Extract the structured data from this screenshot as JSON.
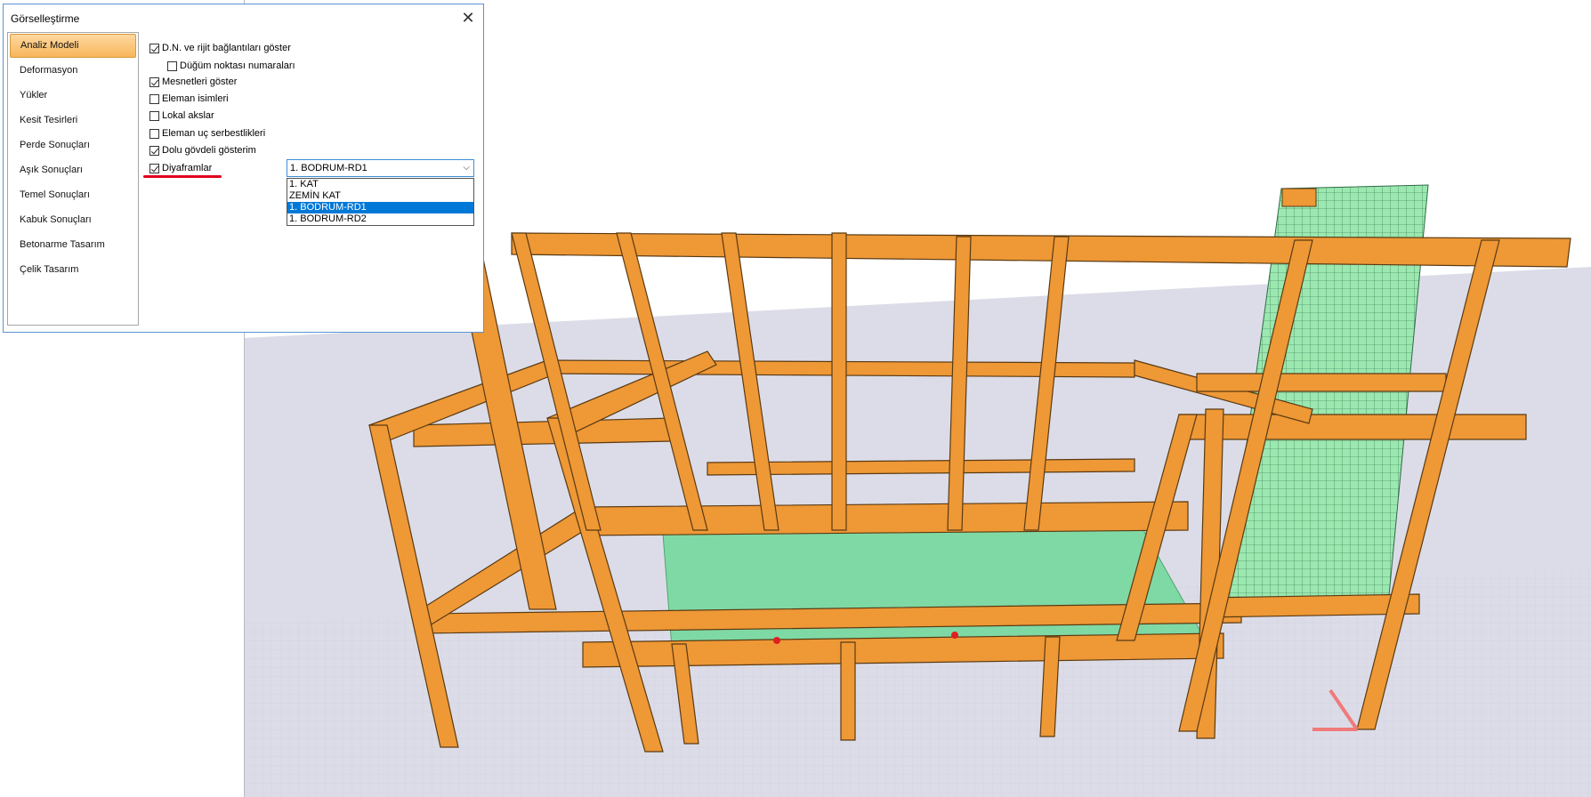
{
  "dialog": {
    "title": "Görselleştirme",
    "close_glyph": "✕"
  },
  "sidebar": {
    "items": [
      {
        "label": "Analiz Modeli",
        "active": true
      },
      {
        "label": "Deformasyon"
      },
      {
        "label": "Yükler"
      },
      {
        "label": "Kesit Tesirleri"
      },
      {
        "label": "Perde Sonuçları"
      },
      {
        "label": "Aşık Sonuçları"
      },
      {
        "label": "Temel Sonuçları"
      },
      {
        "label": "Kabuk Sonuçları"
      },
      {
        "label": "Betonarme Tasarım"
      },
      {
        "label": "Çelik Tasarım"
      }
    ]
  },
  "options": {
    "show_rigid_links": {
      "label": "D.N. ve rijit bağlantıları göster",
      "checked": true
    },
    "node_numbers": {
      "label": "Düğüm noktası numaraları",
      "checked": false
    },
    "show_supports": {
      "label": "Mesnetleri göster",
      "checked": true
    },
    "element_names": {
      "label": "Eleman isimleri",
      "checked": false
    },
    "local_axes": {
      "label": "Lokal akslar",
      "checked": false
    },
    "end_releases": {
      "label": "Eleman uç serbestlikleri",
      "checked": false
    },
    "solid_view": {
      "label": "Dolu gövdeli gösterim",
      "checked": true
    },
    "diaphragms": {
      "label": "Diyaframlar",
      "checked": true
    }
  },
  "diaphragm_select": {
    "value": "1. BODRUM-RD1",
    "arrow_glyph": "⌵",
    "options": [
      "1. KAT",
      "ZEMİN KAT",
      "1. BODRUM-RD1",
      "1. BODRUM-RD2"
    ],
    "selected_index": 2
  },
  "colors": {
    "frame": "#ee9836",
    "slab": "#6fd99a",
    "wall_mesh": "#9be8b0",
    "ground": "#dcdce8",
    "accent": "#0078d7",
    "underline": "#e3001b"
  }
}
